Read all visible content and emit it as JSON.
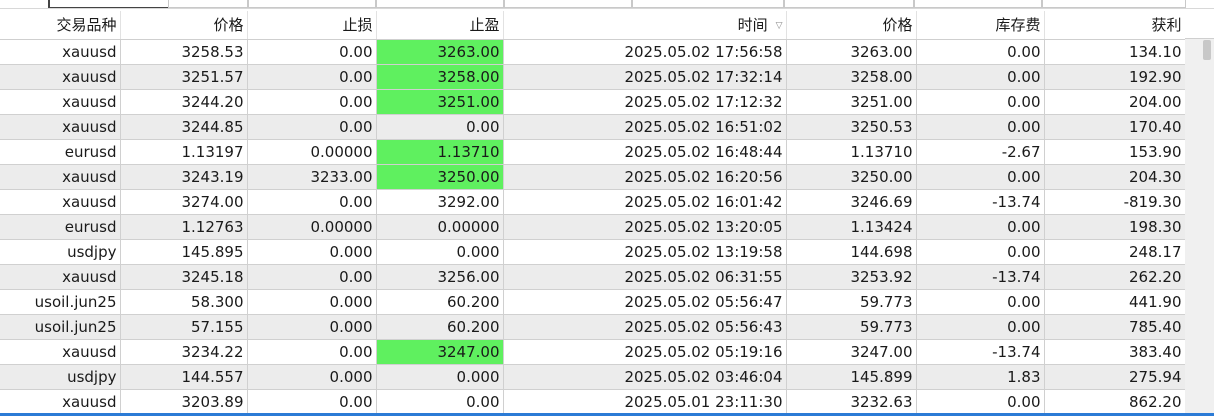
{
  "columns": [
    {
      "key": "symbol",
      "label": "交易品种"
    },
    {
      "key": "open_price",
      "label": "价格"
    },
    {
      "key": "sl",
      "label": "止损"
    },
    {
      "key": "tp",
      "label": "止盈"
    },
    {
      "key": "time",
      "label": "时间",
      "sorted": true
    },
    {
      "key": "close_price",
      "label": "价格"
    },
    {
      "key": "swap",
      "label": "库存费"
    },
    {
      "key": "profit",
      "label": "获利"
    }
  ],
  "sort_indicator": "▽",
  "colors": {
    "tp_hit": "#5ff05f",
    "alt_row": "#ececec",
    "selection_line": "#2b7bd6"
  },
  "rows": [
    {
      "symbol": "xauusd",
      "open_price": "3258.53",
      "sl": "0.00",
      "tp": "3263.00",
      "tp_hit": true,
      "time": "2025.05.02 17:56:58",
      "close_price": "3263.00",
      "swap": "0.00",
      "profit": "134.10"
    },
    {
      "symbol": "xauusd",
      "open_price": "3251.57",
      "sl": "0.00",
      "tp": "3258.00",
      "tp_hit": true,
      "time": "2025.05.02 17:32:14",
      "close_price": "3258.00",
      "swap": "0.00",
      "profit": "192.90"
    },
    {
      "symbol": "xauusd",
      "open_price": "3244.20",
      "sl": "0.00",
      "tp": "3251.00",
      "tp_hit": true,
      "time": "2025.05.02 17:12:32",
      "close_price": "3251.00",
      "swap": "0.00",
      "profit": "204.00"
    },
    {
      "symbol": "xauusd",
      "open_price": "3244.85",
      "sl": "0.00",
      "tp": "0.00",
      "tp_hit": false,
      "time": "2025.05.02 16:51:02",
      "close_price": "3250.53",
      "swap": "0.00",
      "profit": "170.40"
    },
    {
      "symbol": "eurusd",
      "open_price": "1.13197",
      "sl": "0.00000",
      "tp": "1.13710",
      "tp_hit": true,
      "time": "2025.05.02 16:48:44",
      "close_price": "1.13710",
      "swap": "-2.67",
      "profit": "153.90"
    },
    {
      "symbol": "xauusd",
      "open_price": "3243.19",
      "sl": "3233.00",
      "tp": "3250.00",
      "tp_hit": true,
      "time": "2025.05.02 16:20:56",
      "close_price": "3250.00",
      "swap": "0.00",
      "profit": "204.30"
    },
    {
      "symbol": "xauusd",
      "open_price": "3274.00",
      "sl": "0.00",
      "tp": "3292.00",
      "tp_hit": false,
      "time": "2025.05.02 16:01:42",
      "close_price": "3246.69",
      "swap": "-13.74",
      "profit": "-819.30"
    },
    {
      "symbol": "eurusd",
      "open_price": "1.12763",
      "sl": "0.00000",
      "tp": "0.00000",
      "tp_hit": false,
      "time": "2025.05.02 13:20:05",
      "close_price": "1.13424",
      "swap": "0.00",
      "profit": "198.30"
    },
    {
      "symbol": "usdjpy",
      "open_price": "145.895",
      "sl": "0.000",
      "tp": "0.000",
      "tp_hit": false,
      "time": "2025.05.02 13:19:58",
      "close_price": "144.698",
      "swap": "0.00",
      "profit": "248.17"
    },
    {
      "symbol": "xauusd",
      "open_price": "3245.18",
      "sl": "0.00",
      "tp": "3256.00",
      "tp_hit": false,
      "time": "2025.05.02 06:31:55",
      "close_price": "3253.92",
      "swap": "-13.74",
      "profit": "262.20"
    },
    {
      "symbol": "usoil.jun25",
      "open_price": "58.300",
      "sl": "0.000",
      "tp": "60.200",
      "tp_hit": false,
      "time": "2025.05.02 05:56:47",
      "close_price": "59.773",
      "swap": "0.00",
      "profit": "441.90"
    },
    {
      "symbol": "usoil.jun25",
      "open_price": "57.155",
      "sl": "0.000",
      "tp": "60.200",
      "tp_hit": false,
      "time": "2025.05.02 05:56:43",
      "close_price": "59.773",
      "swap": "0.00",
      "profit": "785.40"
    },
    {
      "symbol": "xauusd",
      "open_price": "3234.22",
      "sl": "0.00",
      "tp": "3247.00",
      "tp_hit": true,
      "time": "2025.05.02 05:19:16",
      "close_price": "3247.00",
      "swap": "-13.74",
      "profit": "383.40"
    },
    {
      "symbol": "usdjpy",
      "open_price": "144.557",
      "sl": "0.000",
      "tp": "0.000",
      "tp_hit": false,
      "time": "2025.05.02 03:46:04",
      "close_price": "145.899",
      "swap": "1.83",
      "profit": "275.94"
    },
    {
      "symbol": "xauusd",
      "open_price": "3203.89",
      "sl": "0.00",
      "tp": "0.00",
      "tp_hit": false,
      "time": "2025.05.01 23:11:30",
      "close_price": "3232.63",
      "swap": "0.00",
      "profit": "862.20"
    }
  ]
}
